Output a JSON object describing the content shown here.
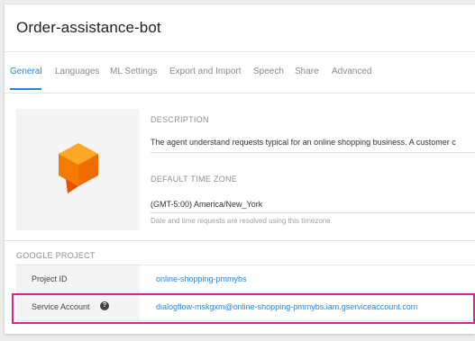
{
  "header": {
    "title": "Order-assistance-bot"
  },
  "tabs": [
    {
      "label": "General"
    },
    {
      "label": "Languages"
    },
    {
      "label": "ML Settings"
    },
    {
      "label": "Export and Import"
    },
    {
      "label": "Speech"
    },
    {
      "label": "Share"
    },
    {
      "label": "Advanced"
    }
  ],
  "general": {
    "description_label": "DESCRIPTION",
    "description_value": "The agent understand requests typical for an online shopping business. A customer c",
    "timezone_label": "DEFAULT TIME ZONE",
    "timezone_value": "(GMT-5:00) America/New_York",
    "timezone_hint": "Date and time requests are resolved using this timezone."
  },
  "google_project": {
    "label": "GOOGLE PROJECT",
    "rows": [
      {
        "key": "Project ID",
        "value": "online-shopping-pmmybs"
      },
      {
        "key": "Service Account",
        "value": "dialogflow-mskgxm@online-shopping-pmmybs.iam.gserviceaccount.com"
      }
    ]
  },
  "colors": {
    "accent": "#1e88e5",
    "highlight": "#e0208c",
    "logo": "#f57c00"
  },
  "icons": {
    "avatar": "dialogflow-logo-icon",
    "help": "question-circle-icon"
  }
}
